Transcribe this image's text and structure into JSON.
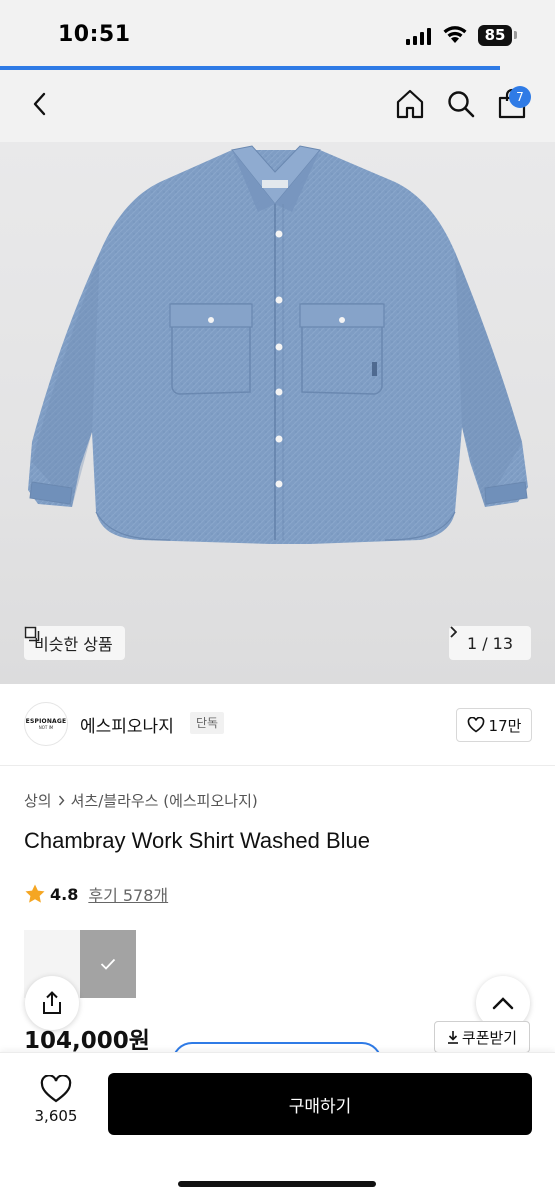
{
  "status_bar": {
    "time": "10:51",
    "battery": "85"
  },
  "page_load_progress": 0.9,
  "header": {
    "back_icon": "chevron-left-icon",
    "home_icon": "home-icon",
    "search_icon": "search-icon",
    "cart_icon": "shopping-bag-icon",
    "cart_count": "7"
  },
  "gallery": {
    "similar_label": "비슷한 상품",
    "pager": "1 / 13",
    "current": 1,
    "total": 13
  },
  "brand": {
    "logo_text": "ESPIONAGE",
    "logo_subtext": "NOT IM",
    "name": "에스피오나지",
    "tag": "단독",
    "likes": "17만"
  },
  "product": {
    "breadcrumb": [
      "상의",
      "셔츠/블라우스 (에스피오나지)"
    ],
    "title": "Chambray Work Shirt Washed Blue",
    "rating": "4.8",
    "reviews": "후기 578개",
    "price": "104,000원",
    "coupon_label": "쿠폰받기"
  },
  "bottom_bar": {
    "wishlist_count": "3,605",
    "buy_label": "구매하기"
  },
  "colors": {
    "accent": "#2f7be6",
    "buy_button": "#000000",
    "star": "#f5a623",
    "denim": "#7f9dc4"
  }
}
